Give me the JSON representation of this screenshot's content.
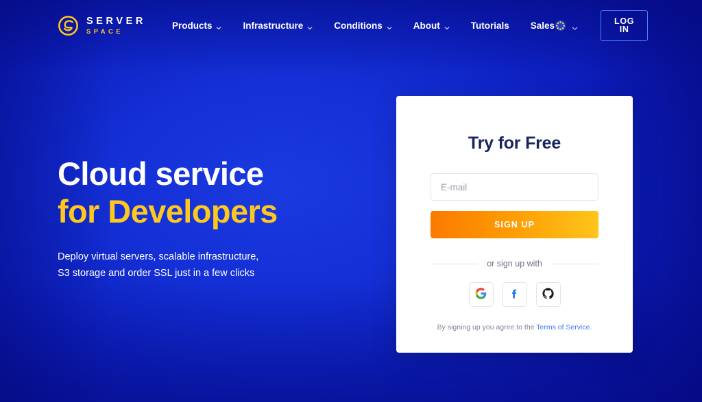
{
  "header": {
    "logo": {
      "mark_icon": "serverspace-circle-s-icon",
      "line1": "SERVER",
      "line2": "SPACE"
    },
    "nav": [
      {
        "label": "Products",
        "has_dropdown": true,
        "icon": "chevron-down-icon"
      },
      {
        "label": "Infrastructure",
        "has_dropdown": true,
        "icon": "chevron-down-icon"
      },
      {
        "label": "Conditions",
        "has_dropdown": true,
        "icon": "chevron-down-icon"
      },
      {
        "label": "About",
        "has_dropdown": true,
        "icon": "chevron-down-icon"
      },
      {
        "label": "Tutorials",
        "has_dropdown": false,
        "icon": ""
      },
      {
        "label": "Sales",
        "has_dropdown": false,
        "icon": ""
      }
    ],
    "language": {
      "flag_icon": "eu-flag-icon",
      "chevron_icon": "chevron-down-icon"
    },
    "login_label": "LOG IN"
  },
  "hero": {
    "title_line_1": "Cloud service",
    "title_line_2": "for Developers",
    "subtitle_line_1": "Deploy virtual servers, scalable infrastructure,",
    "subtitle_line_2": "S3 storage and order SSL just in a few clicks"
  },
  "signup_card": {
    "title": "Try for Free",
    "email": {
      "value": "",
      "placeholder": "E-mail"
    },
    "submit_label": "SIGN UP",
    "divider_label": "or sign up with",
    "social_buttons": [
      {
        "name": "google",
        "icon": "google-icon"
      },
      {
        "name": "facebook",
        "icon": "facebook-icon"
      },
      {
        "name": "github",
        "icon": "github-icon"
      }
    ],
    "terms_prefix": "By signing up you agree to the ",
    "terms_link": "Terms of Service",
    "terms_suffix": "."
  },
  "colors": {
    "background_deep": "#0a15a8",
    "background_bright": "#1a3ae0",
    "accent_yellow": "#ffc81f",
    "cta_orange": "#fb7a00",
    "cta_yellow": "#ffc41a",
    "card_background": "#ffffff",
    "card_title": "#17255c",
    "link_blue": "#3d7bf7",
    "login_border": "#4d80ff"
  }
}
